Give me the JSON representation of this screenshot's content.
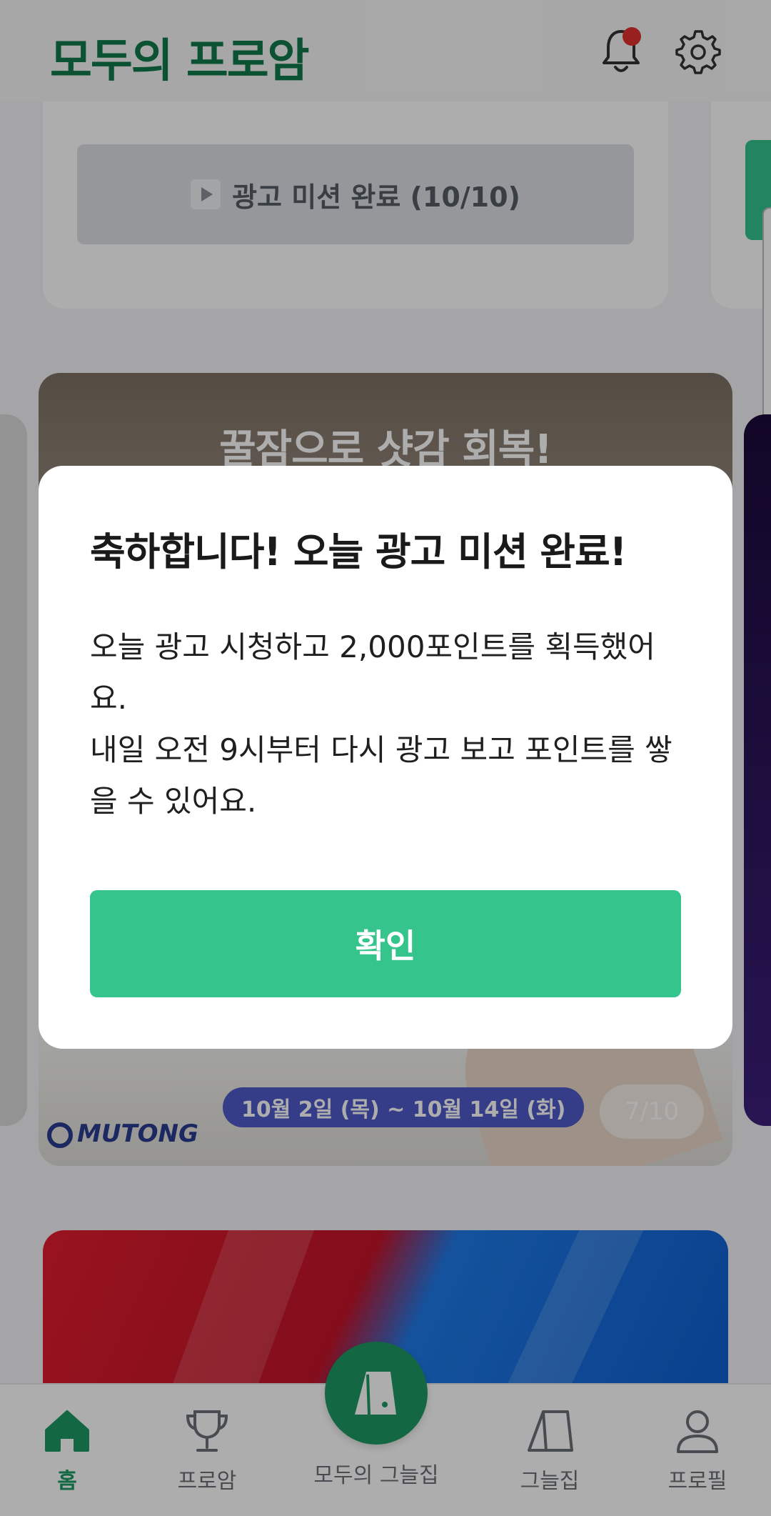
{
  "header": {
    "logo_text": "모두의 프로암",
    "notification_badge": true
  },
  "mission": {
    "button_label": "광고 미션 완료 (10/10)",
    "completed": 10,
    "total": 10
  },
  "banner": {
    "title": "꿀잠으로 샷감 회복!",
    "brand": "MUTONG",
    "date_range": "10월 2일 (목) ~ 10월 14일 (화)",
    "page_indicator": "7/10"
  },
  "dialog": {
    "title": "축하합니다! 오늘 광고 미션 완료!",
    "body_line1": "오늘 광고 시청하고 2,000포인트를 획득했어요.",
    "body_line2": "내일 오전 9시부터 다시 광고 보고 포인트를 쌓을 수 있어요.",
    "confirm_label": "확인"
  },
  "bottom_nav": {
    "items": [
      {
        "label": "홈",
        "icon": "home-icon",
        "active": true
      },
      {
        "label": "프로암",
        "icon": "trophy-icon",
        "active": false
      },
      {
        "label": "모두의 그늘집",
        "icon": "shelter-logo-icon",
        "active": false
      },
      {
        "label": "그늘집",
        "icon": "shelter-icon",
        "active": false
      },
      {
        "label": "프로필",
        "icon": "profile-icon",
        "active": false
      }
    ]
  },
  "colors": {
    "brand_green": "#1c9a63",
    "button_green": "#34c48c",
    "logo_green": "#0f7a4a",
    "badge_red": "#e0312e"
  }
}
